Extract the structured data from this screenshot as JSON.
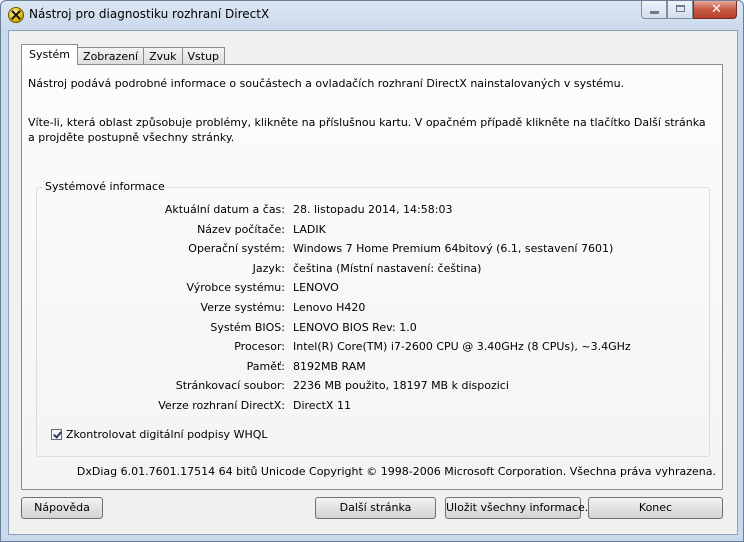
{
  "window": {
    "title": "Nástroj pro diagnostiku rozhraní DirectX",
    "caption": {
      "close_glyph": "✕"
    }
  },
  "tabs": [
    {
      "label": "Systém",
      "active": true
    },
    {
      "label": "Zobrazení",
      "active": false
    },
    {
      "label": "Zvuk",
      "active": false
    },
    {
      "label": "Vstup",
      "active": false
    }
  ],
  "intro": {
    "line1": "Nástroj podává podrobné informace o součástech a ovladačích rozhraní DirectX nainstalovaných v systému.",
    "line2": "Víte-li, která oblast způsobuje problémy, klikněte na příslušnou kartu. V opačném případě klikněte na tlačítko Další stránka a projděte postupně všechny stránky."
  },
  "system_info": {
    "group_title": "Systémové informace",
    "rows": [
      {
        "label": "Aktuální datum a čas:",
        "value": "28. listopadu 2014, 14:58:03"
      },
      {
        "label": "Název počítače:",
        "value": "LADIK"
      },
      {
        "label": "Operační systém:",
        "value": "Windows 7 Home Premium 64bitový (6.1, sestavení 7601)"
      },
      {
        "label": "Jazyk:",
        "value": "čeština (Místní nastavení: čeština)"
      },
      {
        "label": "Výrobce systému:",
        "value": "LENOVO"
      },
      {
        "label": "Verze systému:",
        "value": "Lenovo H420"
      },
      {
        "label": "Systém BIOS:",
        "value": "LENOVO BIOS Rev: 1.0"
      },
      {
        "label": "Procesor:",
        "value": "Intel(R) Core(TM) i7-2600 CPU @ 3.40GHz (8 CPUs), ~3.4GHz"
      },
      {
        "label": "Paměť:",
        "value": "8192MB RAM"
      },
      {
        "label": "Stránkovací soubor:",
        "value": "2236 MB použito, 18197 MB k dispozici"
      },
      {
        "label": "Verze rozhraní DirectX:",
        "value": "DirectX 11"
      }
    ],
    "whql_checkbox": {
      "label": "Zkontrolovat digitální podpisy WHQL",
      "checked": true
    }
  },
  "copyright": "DxDiag 6.01.7601.17514 64 bitů Unicode Copyright © 1998-2006 Microsoft Corporation. Všechna práva vyhrazena.",
  "buttons": {
    "help": "Nápověda",
    "next_page": "Další stránka",
    "save_all": "Uložit všechny informace...",
    "exit": "Konec"
  }
}
